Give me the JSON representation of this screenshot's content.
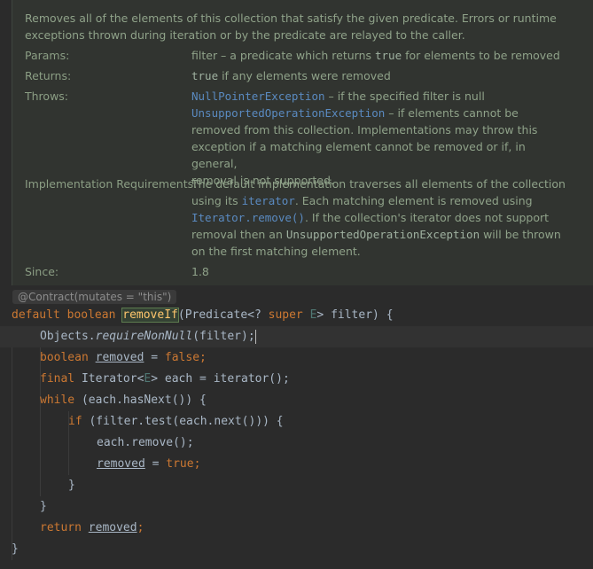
{
  "doc": {
    "description": "Removes all of the elements of this collection that satisfy the given predicate. Errors or runtime exceptions thrown during iteration or by the predicate are relayed to the caller.",
    "params_label": "Params:",
    "params_pre": "filter – a predicate which returns ",
    "params_code": "true",
    "params_post": " for elements to be removed",
    "returns_label": "Returns:",
    "returns_code": "true",
    "returns_post": " if any elements were removed",
    "throws_label": "Throws:",
    "throws_1_code": "NullPointerException",
    "throws_1_post": " – if the specified filter is null",
    "throws_2_code": "UnsupportedOperationException",
    "throws_2_post": " – if elements cannot be",
    "throws_2_l2": "removed from this collection. Implementations may throw this",
    "throws_2_l3": "exception if a matching element cannot be removed or if, in general,",
    "throws_2_l4": "removal is not supported.",
    "impl_label": "Implementation Requirements:",
    "impl_l1": "The default implementation traverses all elements of the collection",
    "impl_l2_pre": "using its ",
    "impl_l2_code": "iterator",
    "impl_l2_post": ". Each matching element is removed using",
    "impl_l3_code": "Iterator.remove()",
    "impl_l3_post": ". If the collection's iterator does not support",
    "impl_l4_pre": "removal then an ",
    "impl_l4_code": "UnsupportedOperationException",
    "impl_l4_post": " will be thrown",
    "impl_l5": "on the first matching element.",
    "since_label": "Since:",
    "since_value": "1.8"
  },
  "contract": "@Contract(mutates = \"this\")",
  "code": {
    "l1": {
      "kw1": "default",
      "kw2": "boolean",
      "name": "removeIf",
      "rest1": "(Predicate<? ",
      "kw3": "super",
      "tp": "E",
      "rest2": "> filter) {"
    },
    "l2": {
      "a": "Objects.",
      "b": "requireNonNull",
      "c": "(filter);"
    },
    "l3": {
      "kw": "boolean",
      "var": "removed",
      "eq": " = ",
      "val": "false",
      "semi": ";"
    },
    "l4": {
      "kw": "final",
      "a": " Iterator<",
      "tp": "E",
      "b": "> each = iterator();"
    },
    "l5": {
      "kw": "while",
      "a": " (each.hasNext()) {"
    },
    "l6": {
      "kw": "if",
      "a": " (filter.test(each.next())) {"
    },
    "l7": {
      "a": "each.remove();"
    },
    "l8": {
      "var": "removed",
      "eq": " = ",
      "val": "true",
      "semi": ";"
    },
    "l9": "}",
    "l10": "}",
    "l11": {
      "kw": "return",
      "var": "removed",
      "semi": ";"
    },
    "l12": "}"
  },
  "colors": {
    "background": "#2b2b2b",
    "doc_background": "#313430",
    "keyword": "#cc7832",
    "method": "#ffc66d",
    "link": "#5a8ac0"
  }
}
